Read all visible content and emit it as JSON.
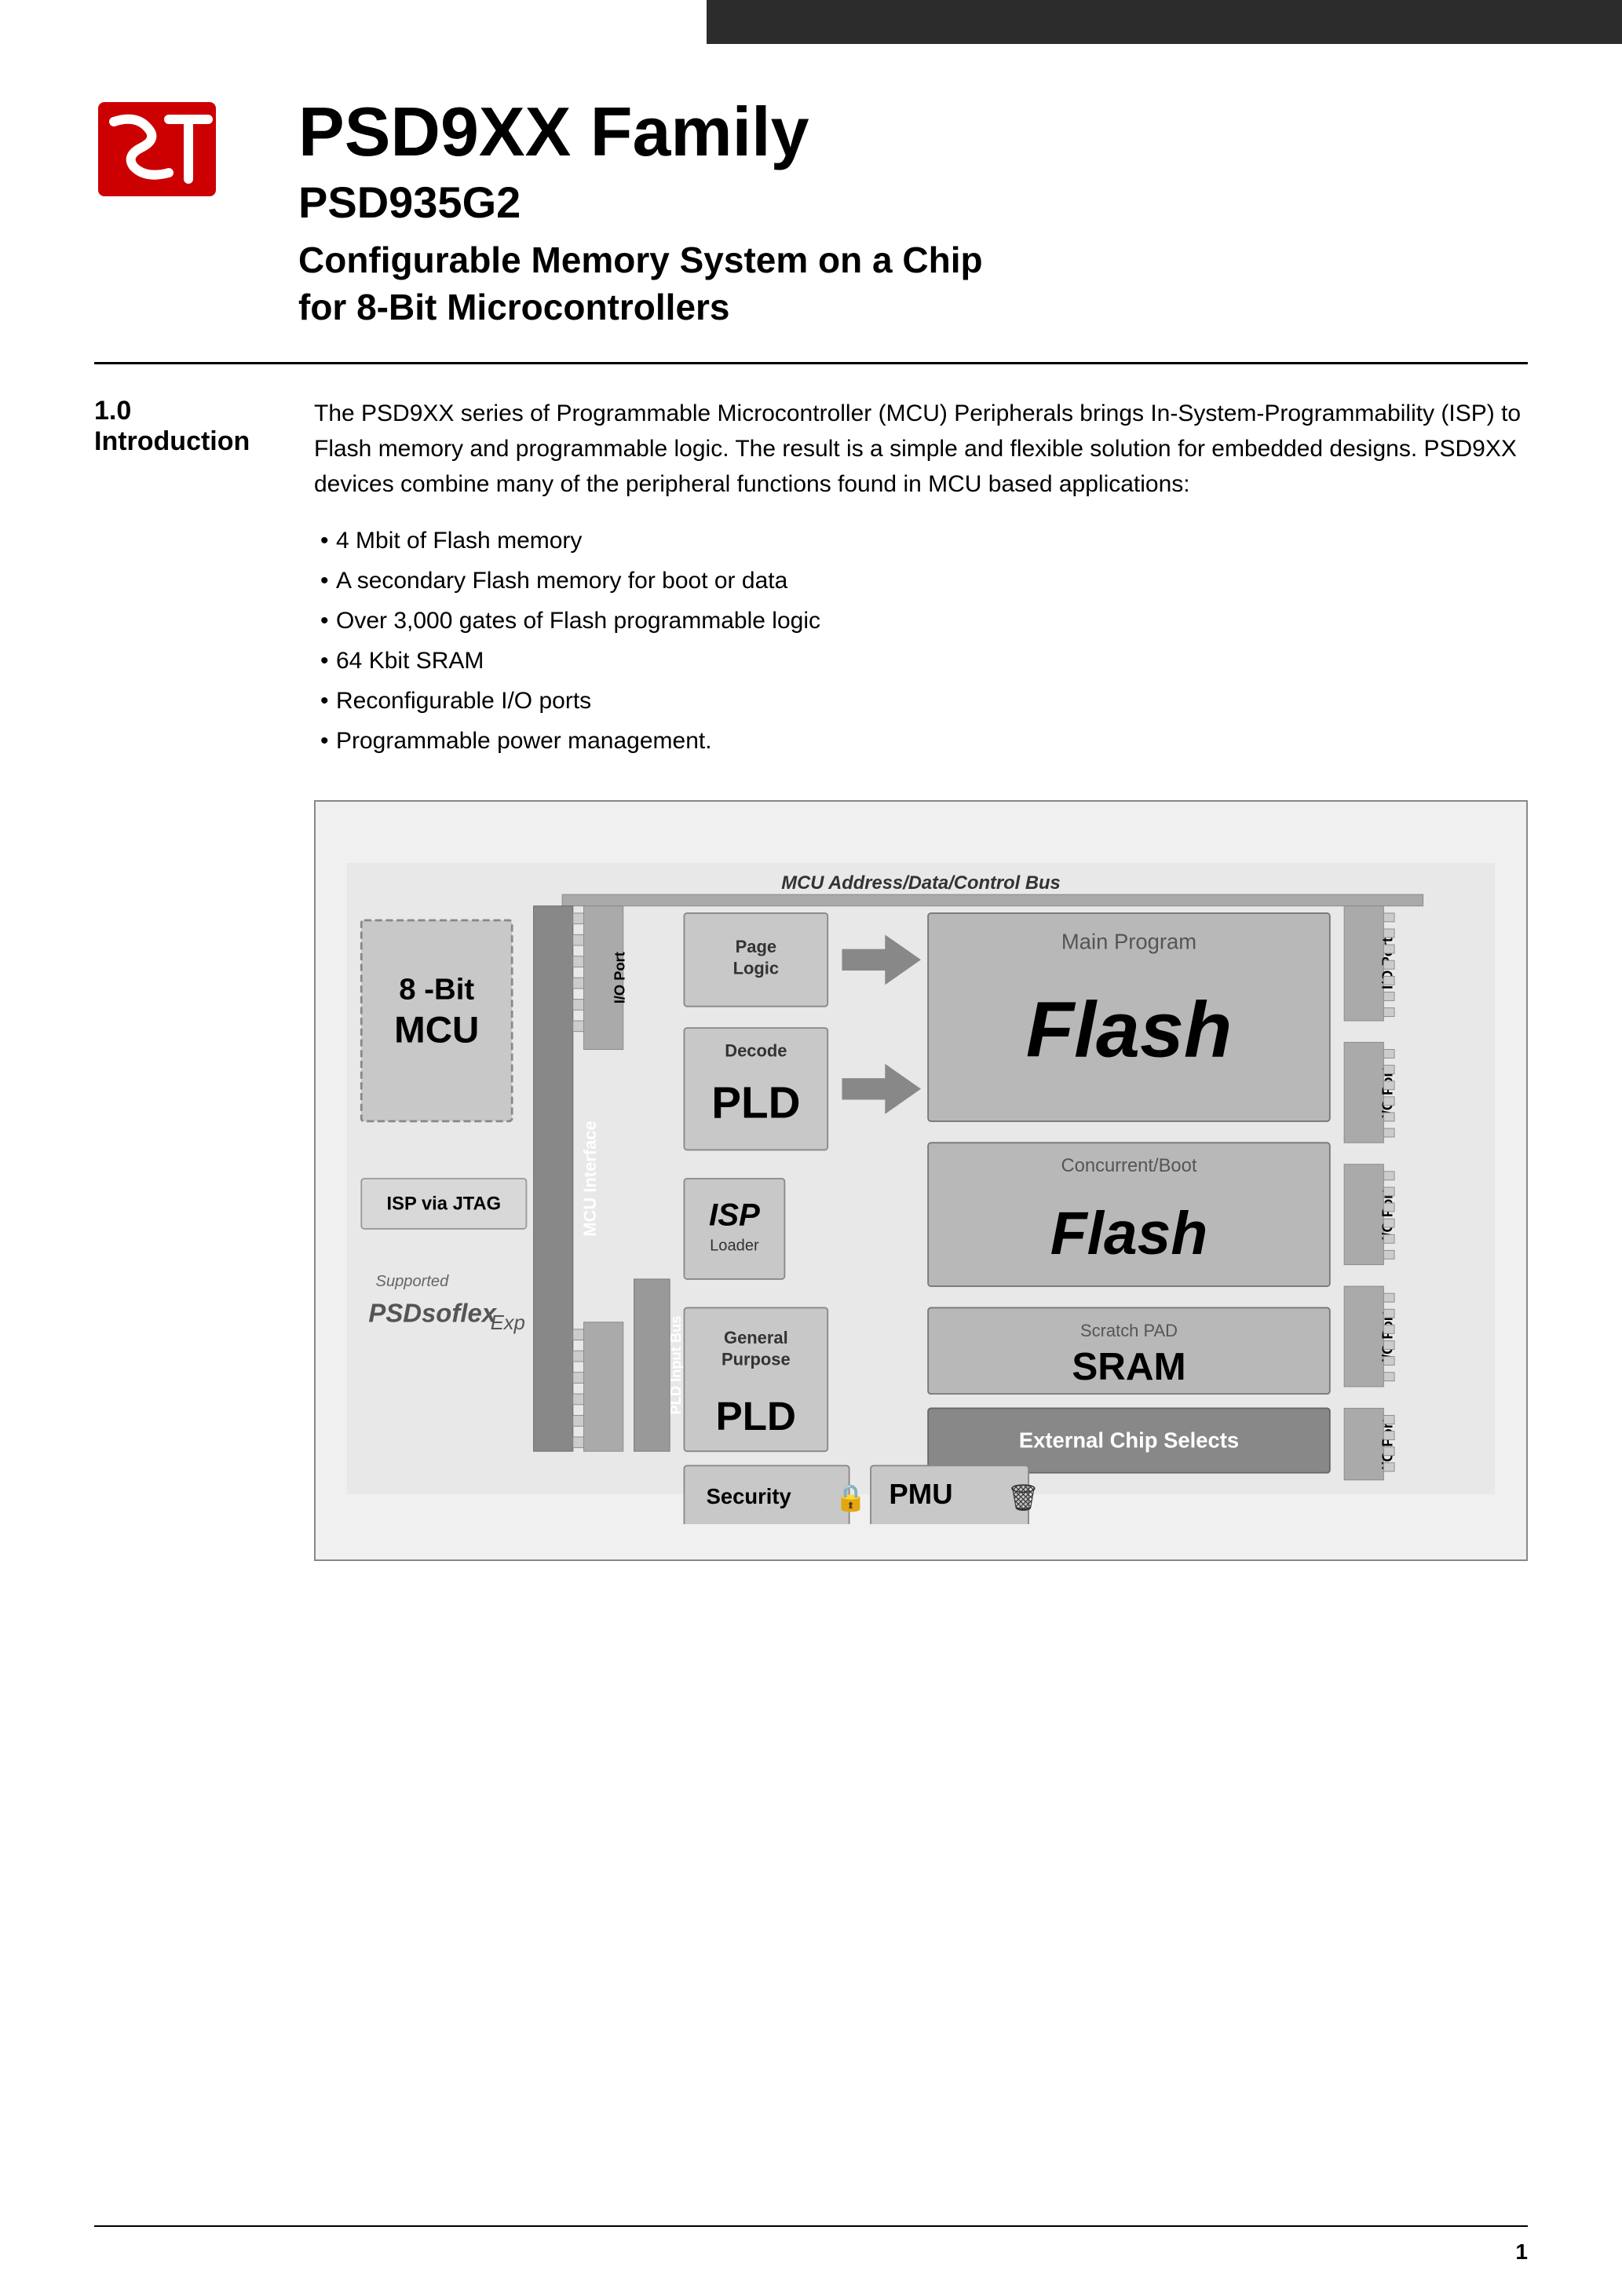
{
  "header": {
    "bar_color": "#2c2c2c"
  },
  "title": {
    "main": "PSD9XX Family",
    "model": "PSD935G2",
    "description_line1": "Configurable Memory System on a Chip",
    "description_line2": "for 8-Bit Microcontrollers"
  },
  "section": {
    "number": "1.0",
    "name": "Introduction"
  },
  "intro": {
    "paragraph": "The PSD9XX series of Programmable Microcontroller (MCU) Peripherals brings In-System-Programmability (ISP) to Flash memory and programmable logic. The result is a simple and flexible solution for embedded designs. PSD9XX devices combine many of the peripheral functions found in MCU based applications:",
    "bullets": [
      "4 Mbit of Flash memory",
      "A secondary Flash memory for boot or data",
      "Over 3,000 gates of Flash programmable logic",
      "64 Kbit SRAM",
      "Reconfigurable I/O ports",
      "Programmable power management."
    ]
  },
  "diagram": {
    "bus_label": "MCU Address/Data/Control Bus",
    "mcu": {
      "bit_label": "8 -Bit",
      "name": "MCU"
    },
    "mcu_interface": "MCU Interface",
    "isp_jtag": "ISP via JTAG",
    "psdsoft": "PSDsoflex",
    "supported": "Supported",
    "page_logic": {
      "line1": "Page",
      "line2": "Logic"
    },
    "decode_pld": {
      "decode": "Decode",
      "pld": "PLD"
    },
    "isp_loader": {
      "isp": "ISP",
      "loader": "Loader"
    },
    "gp_pld": {
      "line1": "General",
      "line2": "Purpose",
      "pld": "PLD"
    },
    "main_flash": {
      "label": "Main Program",
      "flash": "Flash"
    },
    "boot_flash": {
      "label": "Concurrent/Boot",
      "flash": "Flash"
    },
    "sram": {
      "label": "Scratch PAD",
      "sram": "SRAM"
    },
    "ext_chip": "External Chip Selects",
    "security": "Security",
    "pmu": "PMU",
    "io_port": "I/O Port",
    "pld_input_bus": "PLD Input Bus"
  },
  "footer": {
    "page_number": "1"
  }
}
